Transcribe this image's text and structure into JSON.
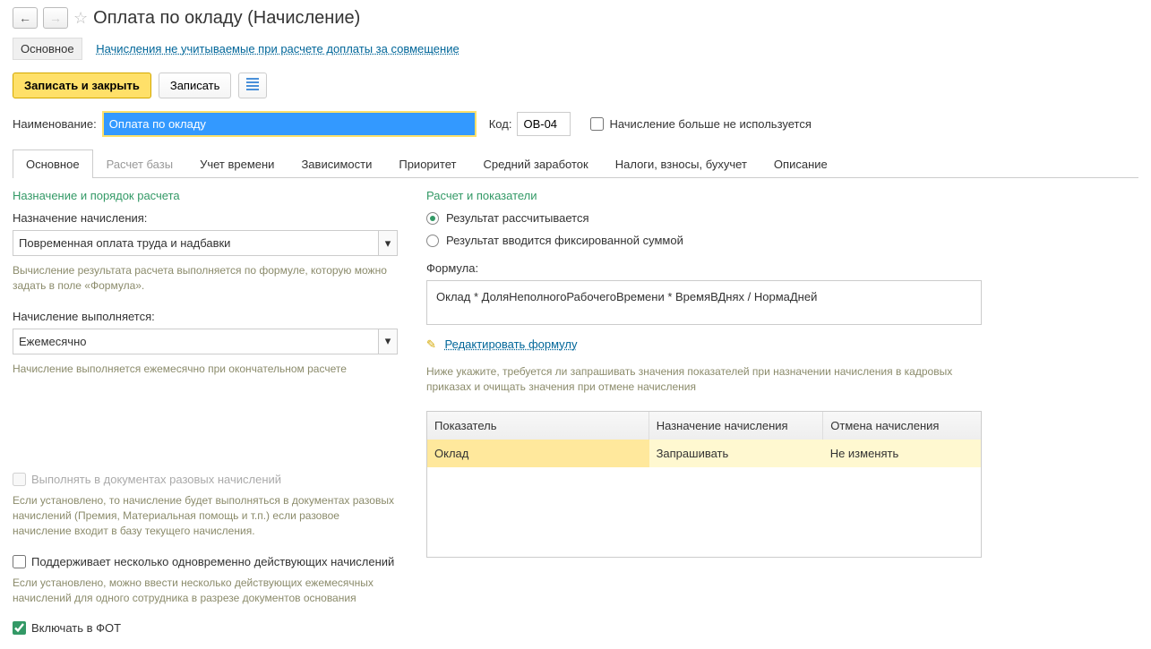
{
  "header": {
    "title": "Оплата по окладу (Начисление)"
  },
  "nav": {
    "main_tab": "Основное",
    "link1": "Начисления не учитываемые при расчете доплаты за совмещение"
  },
  "toolbar": {
    "save_close": "Записать и закрыть",
    "save": "Записать"
  },
  "form": {
    "name_label": "Наименование:",
    "name_value": "Оплата по окладу",
    "code_label": "Код:",
    "code_value": "ОВ-04",
    "not_used": "Начисление больше не используется"
  },
  "tabs": [
    "Основное",
    "Расчет базы",
    "Учет времени",
    "Зависимости",
    "Приоритет",
    "Средний заработок",
    "Налоги, взносы, бухучет",
    "Описание"
  ],
  "left": {
    "section": "Назначение и порядок расчета",
    "purpose_label": "Назначение начисления:",
    "purpose_value": "Повременная оплата труда и надбавки",
    "purpose_hint": "Вычисление результата расчета выполняется по формуле, которую можно задать в поле «Формула».",
    "exec_label": "Начисление выполняется:",
    "exec_value": "Ежемесячно",
    "exec_hint": "Начисление выполняется ежемесячно при окончательном расчете",
    "onetime_chk": "Выполнять в документах разовых начислений",
    "onetime_hint": "Если установлено, то начисление будет выполняться в документах разовых начислений (Премия, Материальная помощь и т.п.) если разовое начисление входит в базу текущего начисления.",
    "multi_chk": "Поддерживает несколько одновременно действующих начислений",
    "multi_hint": "Если установлено, можно ввести несколько действующих ежемесячных начислений для одного сотрудника в разрезе документов основания",
    "fot_chk": "Включать в ФОТ"
  },
  "right": {
    "section": "Расчет и показатели",
    "radio1": "Результат рассчитывается",
    "radio2": "Результат вводится фиксированной суммой",
    "formula_label": "Формула:",
    "formula_value": "Оклад * ДоляНеполногоРабочегоВремени * ВремяВДнях / НормаДней",
    "edit_link": "Редактировать формулу",
    "table_hint": "Ниже укажите, требуется ли запрашивать значения показателей при назначении начисления в кадровых приказах и очищать значения при отмене начисления",
    "th1": "Показатель",
    "th2": "Назначение начисления",
    "th3": "Отмена начисления",
    "td1": "Оклад",
    "td2": "Запрашивать",
    "td3": "Не изменять"
  }
}
